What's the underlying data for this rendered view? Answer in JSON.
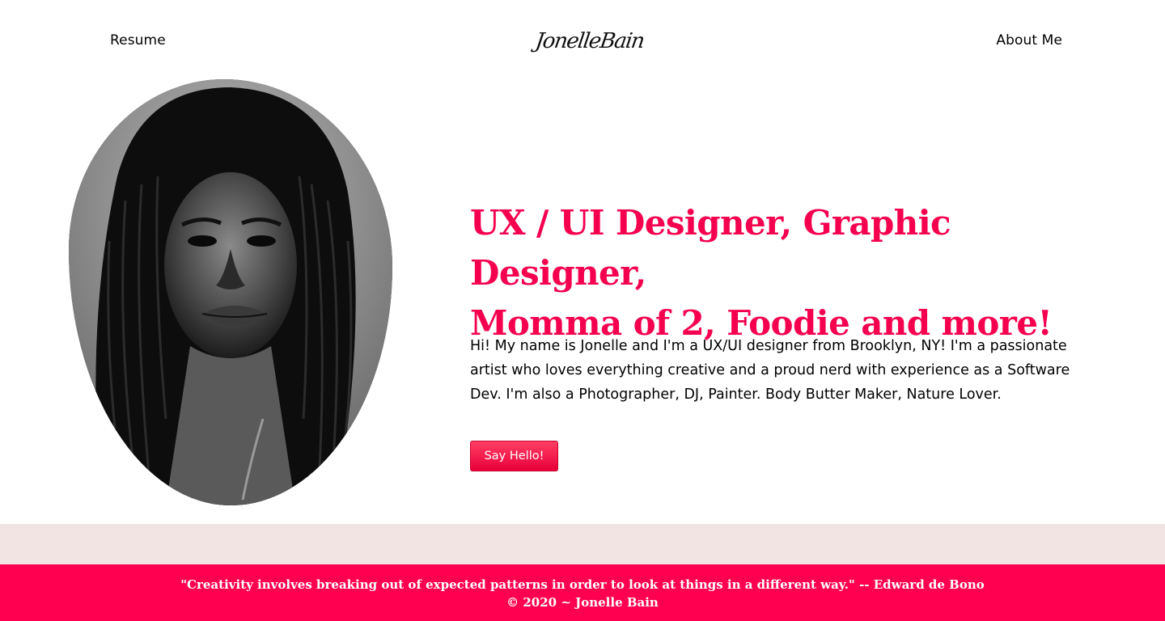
{
  "nav": {
    "resume_label": "Resume",
    "about_label": "About Me",
    "logo_text": "JonelleBain"
  },
  "hero": {
    "headline_line1": "UX / UI Designer, Graphic Designer,",
    "headline_line2": "Momma of 2, Foodie and more!",
    "intro": "Hi! My name is Jonelle and I'm a UX/UI designer from Brooklyn, NY! I'm a passionate artist who loves everything creative and a proud nerd with experience as a Software Dev. I'm also a Photographer, DJ, Painter. Body Butter Maker, Nature Lover.",
    "cta_label": "Say Hello!"
  },
  "footer": {
    "quote": "\"Creativity involves breaking out of expected patterns in order to look at things in a different way.\" -- Edward de Bono",
    "copyright": "© 2020 ~ Jonelle Bain"
  },
  "colors": {
    "accent": "#f5004f",
    "footer_bg": "#ff0050",
    "band_bg": "#f1e4e3",
    "button_top": "#ff3f63",
    "button_bottom": "#e8003a"
  }
}
